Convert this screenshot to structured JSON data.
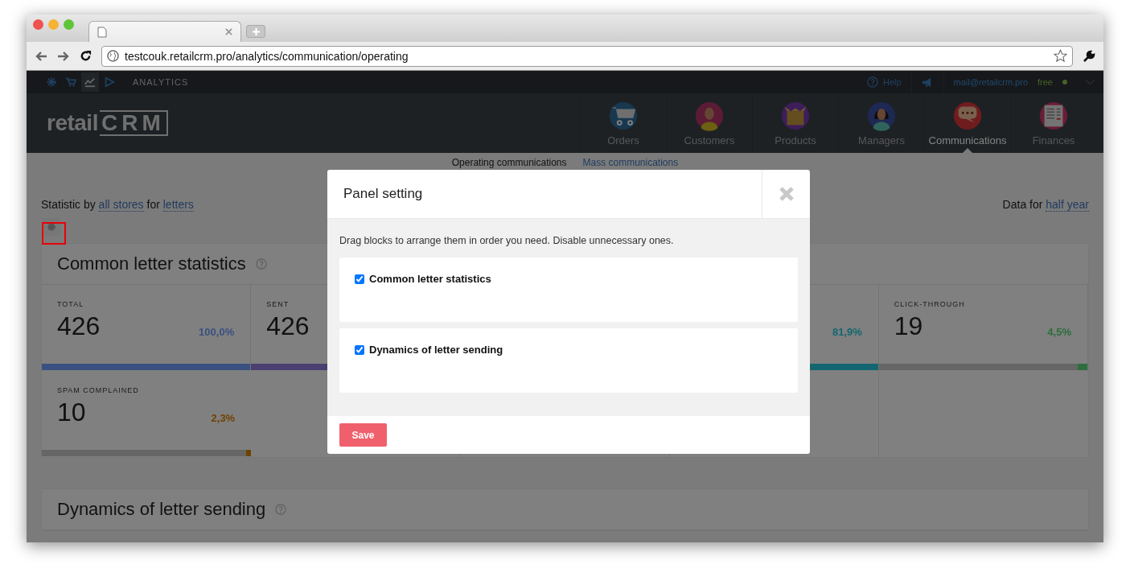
{
  "browser": {
    "url": "testcouk.retailcrm.pro/analytics/communication/operating"
  },
  "app_bar": {
    "icons": [
      {
        "kind": "gear",
        "selected": false
      },
      {
        "kind": "cart",
        "selected": false
      },
      {
        "kind": "chart",
        "selected": true
      },
      {
        "kind": "play",
        "selected": false
      }
    ],
    "section": "ANALYTICS",
    "help": "Help",
    "email": "mail@retailcrm.pro",
    "plan": "free"
  },
  "logo": {
    "text": "retail",
    "mark": "CRM"
  },
  "nav": [
    {
      "label": "Orders",
      "kind": "orders",
      "selected": false
    },
    {
      "label": "Customers",
      "kind": "customers",
      "selected": false
    },
    {
      "label": "Products",
      "kind": "products",
      "selected": false
    },
    {
      "label": "Managers",
      "kind": "managers",
      "selected": false
    },
    {
      "label": "Communications",
      "kind": "communications",
      "selected": true
    },
    {
      "label": "Finances",
      "kind": "finances",
      "selected": false
    }
  ],
  "subnav": [
    {
      "label": "Operating communications",
      "selected": true
    },
    {
      "label": "Mass communications",
      "selected": false
    }
  ],
  "filters": {
    "prefix": "Statistic by",
    "store": "all stores",
    "joiner": "for",
    "channel": "letters",
    "period_prefix": "Data for",
    "period": "half year"
  },
  "panels": [
    {
      "title": "Common letter statistics",
      "metrics": [
        {
          "label": "TOTAL",
          "value": "426",
          "percent": "100,0%",
          "level": 1,
          "color": "#3a5080"
        },
        {
          "label": "SENT",
          "value": "426",
          "level": 1,
          "color": "#4a3f70"
        },
        {
          "percent": "81,9%",
          "level": 0.819,
          "color": "#136670"
        },
        {
          "label": "CLICK-THROUGH",
          "value": "19",
          "percent": "4,5%",
          "level": 0.045,
          "color": "#2d6e3e"
        },
        {
          "label": "SPAM COMPLAINED",
          "value": "10",
          "percent": "2,3%",
          "level": 0.023,
          "color": "#6e4300"
        }
      ]
    },
    {
      "title": "Dynamics of letter sending"
    }
  ],
  "modal": {
    "title": "Panel setting",
    "hint": "Drag blocks to arrange them in order you need. Disable unnecessary ones.",
    "blocks": [
      {
        "label": "Common letter statistics",
        "checked": true
      },
      {
        "label": "Dynamics of letter sending",
        "checked": true
      }
    ],
    "save": "Save"
  }
}
